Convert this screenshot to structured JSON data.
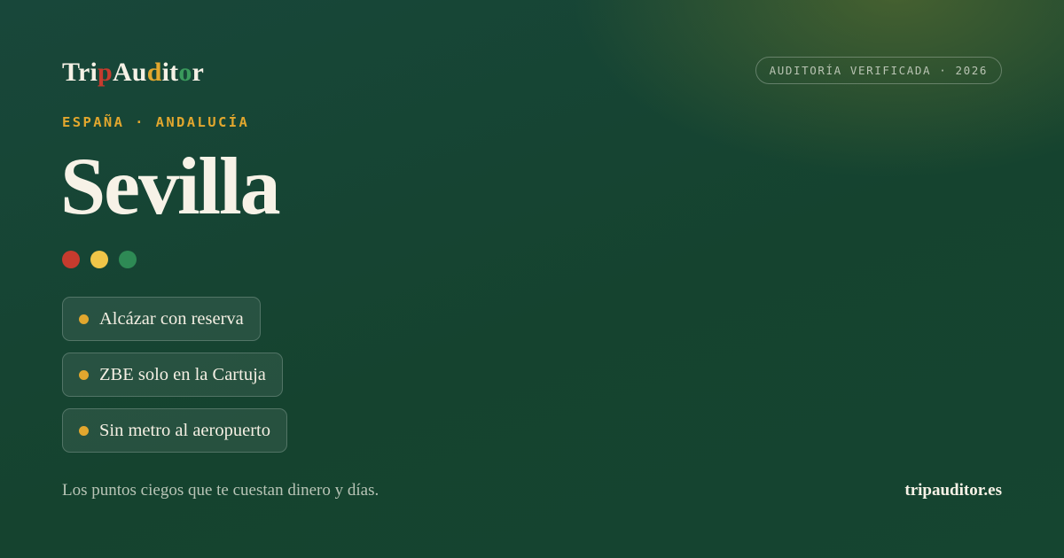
{
  "brand": {
    "parts": [
      {
        "text": "Tri",
        "color": "#f7f2e7"
      },
      {
        "text": "p",
        "color": "#c63b2e"
      },
      {
        "text": "Au",
        "color": "#f7f2e7"
      },
      {
        "text": "d",
        "color": "#e2a72e"
      },
      {
        "text": "it",
        "color": "#f7f2e7"
      },
      {
        "text": "o",
        "color": "#3a9a5c"
      },
      {
        "text": "r",
        "color": "#f7f2e7"
      }
    ]
  },
  "badge": {
    "label": "AUDITORÍA VERIFICADA · 2026"
  },
  "location": {
    "region": "ESPAÑA · ANDALUCÍA",
    "city": "Sevilla"
  },
  "status_dots": [
    {
      "name": "red-dot",
      "color": "#c63b2e"
    },
    {
      "name": "yellow-dot",
      "color": "#f0c548"
    },
    {
      "name": "green-dot",
      "color": "#2e8a55"
    }
  ],
  "highlights": [
    {
      "text": "Alcázar con reserva"
    },
    {
      "text": "ZBE solo en la Cartuja"
    },
    {
      "text": "Sin metro al aeropuerto"
    }
  ],
  "footer": {
    "tagline": "Los puntos ciegos que te cuestan dinero y días.",
    "site": "tripauditor.es"
  },
  "colors": {
    "accent": "#e2a72e",
    "background": "#15432f",
    "text": "#f7f2e7"
  }
}
